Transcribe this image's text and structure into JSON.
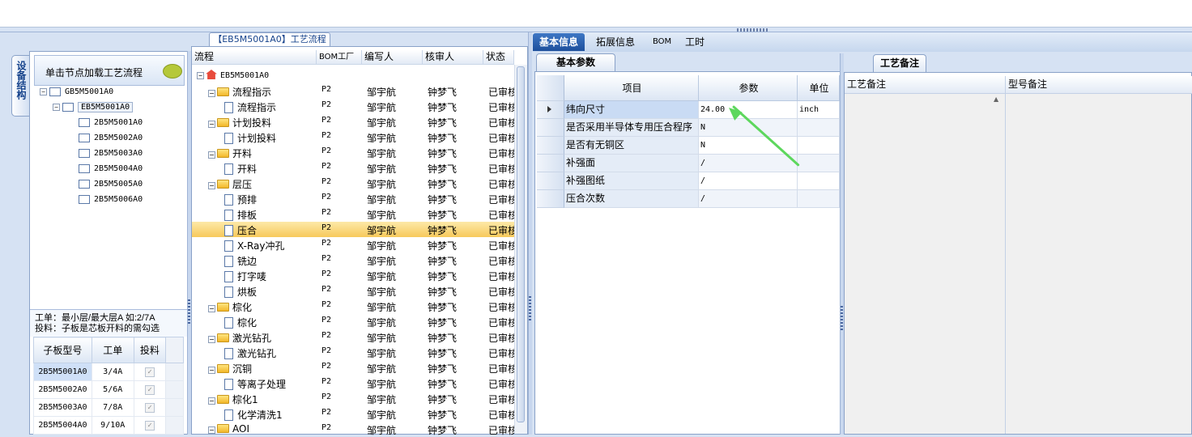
{
  "left": {
    "vertical_tab": "设备结构",
    "hint": "单击节点加载工艺流程",
    "tree": [
      {
        "label": "GB5M5001A0",
        "level": 0,
        "expander": "−"
      },
      {
        "label": "EB5M5001A0",
        "level": 1,
        "expander": "−",
        "selected": true
      },
      {
        "label": "2B5M5001A0",
        "level": 2
      },
      {
        "label": "2B5M5002A0",
        "level": 2
      },
      {
        "label": "2B5M5003A0",
        "level": 2
      },
      {
        "label": "2B5M5004A0",
        "level": 2
      },
      {
        "label": "2B5M5005A0",
        "level": 2
      },
      {
        "label": "2B5M5006A0",
        "level": 2
      }
    ],
    "note_line1": "工单：最小层/最大层A 如:2/7A",
    "note_line2": "投料：子板是芯板开料的需勾选",
    "subgrid": {
      "headers": [
        "子板型号",
        "工单",
        "投料"
      ],
      "rows": [
        {
          "model": "2B5M5001A0",
          "order": "3/4A",
          "feed": "✓"
        },
        {
          "model": "2B5M5002A0",
          "order": "5/6A",
          "feed": "✓"
        },
        {
          "model": "2B5M5003A0",
          "order": "7/8A",
          "feed": "✓"
        },
        {
          "model": "2B5M5004A0",
          "order": "9/10A",
          "feed": "✓"
        }
      ]
    }
  },
  "middle": {
    "title": "【EB5M5001A0】工艺流程",
    "headers": [
      "流程",
      "BOM工厂",
      "编写人",
      "核审人",
      "状态"
    ],
    "root": "EB5M5001A0",
    "rows": [
      {
        "label": "流程指示",
        "type": "folder",
        "bom": "P2",
        "writer": "邹宇航",
        "reviewer": "钟梦飞",
        "status": "已审核"
      },
      {
        "label": "流程指示",
        "type": "doc",
        "bom": "P2",
        "writer": "邹宇航",
        "reviewer": "钟梦飞",
        "status": "已审核"
      },
      {
        "label": "计划投料",
        "type": "folder",
        "bom": "P2",
        "writer": "邹宇航",
        "reviewer": "钟梦飞",
        "status": "已审核"
      },
      {
        "label": "计划投料",
        "type": "doc",
        "bom": "P2",
        "writer": "邹宇航",
        "reviewer": "钟梦飞",
        "status": "已审核"
      },
      {
        "label": "开料",
        "type": "folder",
        "bom": "P2",
        "writer": "邹宇航",
        "reviewer": "钟梦飞",
        "status": "已审核"
      },
      {
        "label": "开料",
        "type": "doc",
        "bom": "P2",
        "writer": "邹宇航",
        "reviewer": "钟梦飞",
        "status": "已审核"
      },
      {
        "label": "层压",
        "type": "folder",
        "bom": "P2",
        "writer": "邹宇航",
        "reviewer": "钟梦飞",
        "status": "已审核"
      },
      {
        "label": "预排",
        "type": "doc",
        "bom": "P2",
        "writer": "邹宇航",
        "reviewer": "钟梦飞",
        "status": "已审核"
      },
      {
        "label": "排板",
        "type": "doc",
        "bom": "P2",
        "writer": "邹宇航",
        "reviewer": "钟梦飞",
        "status": "已审核"
      },
      {
        "label": "压合",
        "type": "doc",
        "bom": "P2",
        "writer": "邹宇航",
        "reviewer": "钟梦飞",
        "status": "已审核",
        "selected": true
      },
      {
        "label": "X-Ray冲孔",
        "type": "doc",
        "bom": "P2",
        "writer": "邹宇航",
        "reviewer": "钟梦飞",
        "status": "已审核"
      },
      {
        "label": "铣边",
        "type": "doc",
        "bom": "P2",
        "writer": "邹宇航",
        "reviewer": "钟梦飞",
        "status": "已审核"
      },
      {
        "label": "打字唛",
        "type": "doc",
        "bom": "P2",
        "writer": "邹宇航",
        "reviewer": "钟梦飞",
        "status": "已审核"
      },
      {
        "label": "烘板",
        "type": "doc",
        "bom": "P2",
        "writer": "邹宇航",
        "reviewer": "钟梦飞",
        "status": "已审核"
      },
      {
        "label": "棕化",
        "type": "folder",
        "bom": "P2",
        "writer": "邹宇航",
        "reviewer": "钟梦飞",
        "status": "已审核"
      },
      {
        "label": "棕化",
        "type": "doc",
        "bom": "P2",
        "writer": "邹宇航",
        "reviewer": "钟梦飞",
        "status": "已审核"
      },
      {
        "label": "激光钻孔",
        "type": "folder",
        "bom": "P2",
        "writer": "邹宇航",
        "reviewer": "钟梦飞",
        "status": "已审核"
      },
      {
        "label": "激光钻孔",
        "type": "doc",
        "bom": "P2",
        "writer": "邹宇航",
        "reviewer": "钟梦飞",
        "status": "已审核"
      },
      {
        "label": "沉铜",
        "type": "folder",
        "bom": "P2",
        "writer": "邹宇航",
        "reviewer": "钟梦飞",
        "status": "已审核"
      },
      {
        "label": "等离子处理",
        "type": "doc",
        "bom": "P2",
        "writer": "邹宇航",
        "reviewer": "钟梦飞",
        "status": "已审核"
      },
      {
        "label": "棕化1",
        "type": "folder",
        "bom": "P2",
        "writer": "邹宇航",
        "reviewer": "钟梦飞",
        "status": "已审核"
      },
      {
        "label": "化学清洗1",
        "type": "doc",
        "bom": "P2",
        "writer": "邹宇航",
        "reviewer": "钟梦飞",
        "status": "已审核"
      },
      {
        "label": "AOI",
        "type": "folder",
        "bom": "P2",
        "writer": "邹宇航",
        "reviewer": "钟梦飞",
        "status": "已审核"
      }
    ]
  },
  "right": {
    "tabs": [
      "基本信息",
      "拓展信息",
      "BOM",
      "工时"
    ],
    "subtab": "基本参数",
    "grid_headers": [
      "项目",
      "参数",
      "单位"
    ],
    "params": [
      {
        "item": "纬向尺寸",
        "value": "24.00",
        "unit": "inch"
      },
      {
        "item": "是否采用半导体专用压合程序",
        "value": "N",
        "unit": ""
      },
      {
        "item": "是否有无铜区",
        "value": "N",
        "unit": ""
      },
      {
        "item": "补强面",
        "value": "/",
        "unit": ""
      },
      {
        "item": "补强图纸",
        "value": "/",
        "unit": ""
      },
      {
        "item": "压合次数",
        "value": "/",
        "unit": ""
      }
    ]
  },
  "remarks": {
    "tab": "工艺备注",
    "col1": "工艺备注",
    "col2": "型号备注"
  }
}
